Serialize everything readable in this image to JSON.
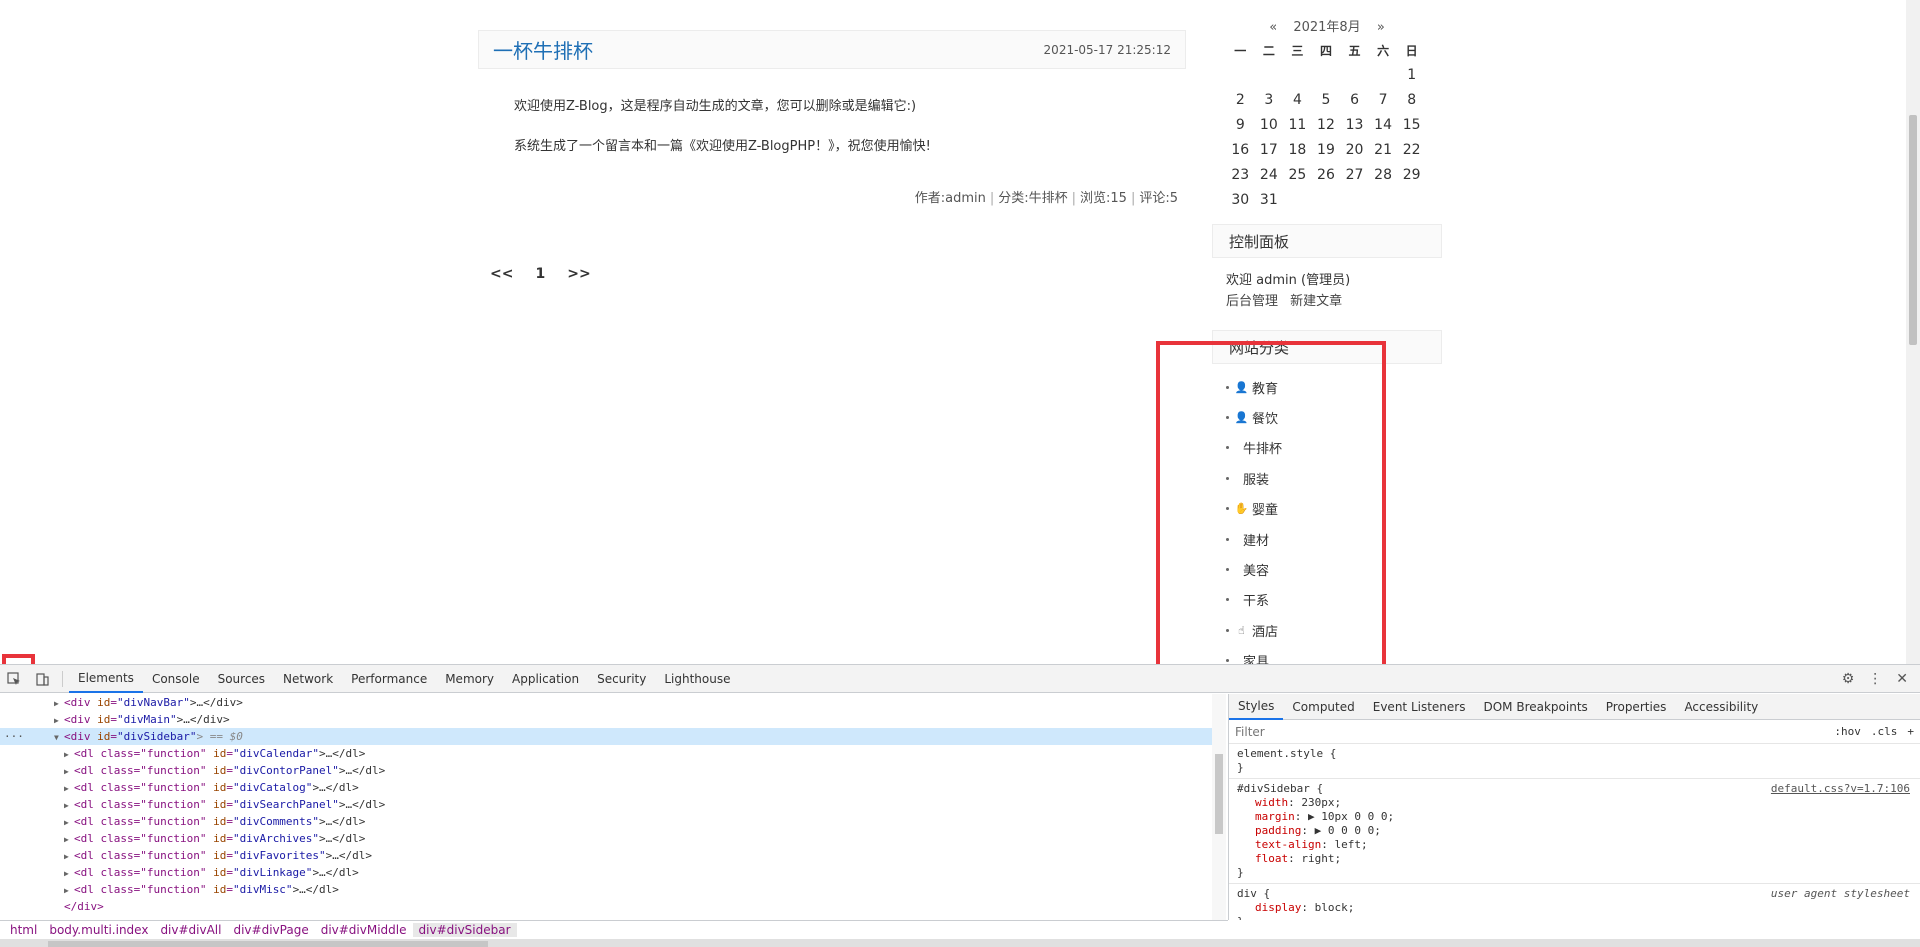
{
  "post": {
    "title": "一杯牛排杯",
    "date": "2021-05-17 21:25:12",
    "paragraphs": [
      "欢迎使用Z-Blog，这是程序自动生成的文章，您可以删除或是编辑它:)",
      "系统生成了一个留言本和一篇《欢迎使用Z-BlogPHP！》，祝您使用愉快!"
    ],
    "meta": {
      "author": "作者:admin",
      "category": "分类:牛排杯",
      "views": "浏览:15",
      "comments": "评论:5"
    }
  },
  "pager": {
    "prev": "<<",
    "page": "1",
    "next": ">>"
  },
  "calendar": {
    "prev": "«",
    "month": "2021年8月",
    "next": "»",
    "weekdays": [
      "一",
      "二",
      "三",
      "四",
      "五",
      "六",
      "日"
    ],
    "weeks": [
      [
        "",
        "",
        "",
        "",
        "",
        "",
        "1"
      ],
      [
        "2",
        "3",
        "4",
        "5",
        "6",
        "7",
        "8"
      ],
      [
        "9",
        "10",
        "11",
        "12",
        "13",
        "14",
        "15"
      ],
      [
        "16",
        "17",
        "18",
        "19",
        "20",
        "21",
        "22"
      ],
      [
        "23",
        "24",
        "25",
        "26",
        "27",
        "28",
        "29"
      ],
      [
        "30",
        "31",
        "",
        "",
        "",
        "",
        ""
      ]
    ]
  },
  "control_panel": {
    "title": "控制面板",
    "welcome": "欢迎 admin (管理员)",
    "links": [
      "后台管理",
      "新建文章"
    ]
  },
  "catalog": {
    "title": "网站分类",
    "items": [
      {
        "label": "教育",
        "icon": "user-card-icon"
      },
      {
        "label": "餐饮",
        "icon": "user-card-icon"
      },
      {
        "label": "牛排杯",
        "icon": ""
      },
      {
        "label": "服装",
        "icon": ""
      },
      {
        "label": "婴童",
        "icon": "hand-icon"
      },
      {
        "label": "建材",
        "icon": ""
      },
      {
        "label": "美容",
        "icon": ""
      },
      {
        "label": "干系",
        "icon": ""
      },
      {
        "label": "酒店",
        "icon": "pointer-hand-icon"
      },
      {
        "label": "家具",
        "icon": ""
      }
    ]
  },
  "devtools": {
    "tabs": [
      "Elements",
      "Console",
      "Sources",
      "Network",
      "Performance",
      "Memory",
      "Application",
      "Security",
      "Lighthouse"
    ],
    "active_tab": "Elements",
    "dom": [
      {
        "indent": 1,
        "arrow": "▶",
        "open": "<div ",
        "attr": "id",
        "val": "\"divNavBar\"",
        "rest": ">…</div>",
        "selected": false
      },
      {
        "indent": 1,
        "arrow": "▶",
        "open": "<div ",
        "attr": "id",
        "val": "\"divMain\"",
        "rest": ">…</div>",
        "selected": false
      },
      {
        "indent": 1,
        "arrow": "▼",
        "open": "<div ",
        "attr": "id",
        "val": "\"divSidebar\"",
        "rest": "> == $0",
        "selected": true
      },
      {
        "indent": 2,
        "arrow": "▶",
        "open": "<dl class=\"function\" ",
        "attr": "id",
        "val": "\"divCalendar\"",
        "rest": ">…</dl>",
        "selected": false
      },
      {
        "indent": 2,
        "arrow": "▶",
        "open": "<dl class=\"function\" ",
        "attr": "id",
        "val": "\"divContorPanel\"",
        "rest": ">…</dl>",
        "selected": false
      },
      {
        "indent": 2,
        "arrow": "▶",
        "open": "<dl class=\"function\" ",
        "attr": "id",
        "val": "\"divCatalog\"",
        "rest": ">…</dl>",
        "selected": false
      },
      {
        "indent": 2,
        "arrow": "▶",
        "open": "<dl class=\"function\" ",
        "attr": "id",
        "val": "\"divSearchPanel\"",
        "rest": ">…</dl>",
        "selected": false
      },
      {
        "indent": 2,
        "arrow": "▶",
        "open": "<dl class=\"function\" ",
        "attr": "id",
        "val": "\"divComments\"",
        "rest": ">…</dl>",
        "selected": false
      },
      {
        "indent": 2,
        "arrow": "▶",
        "open": "<dl class=\"function\" ",
        "attr": "id",
        "val": "\"divArchives\"",
        "rest": ">…</dl>",
        "selected": false
      },
      {
        "indent": 2,
        "arrow": "▶",
        "open": "<dl class=\"function\" ",
        "attr": "id",
        "val": "\"divFavorites\"",
        "rest": ">…</dl>",
        "selected": false
      },
      {
        "indent": 2,
        "arrow": "▶",
        "open": "<dl class=\"function\" ",
        "attr": "id",
        "val": "\"divLinkage\"",
        "rest": ">…</dl>",
        "selected": false
      },
      {
        "indent": 2,
        "arrow": "▶",
        "open": "<dl class=\"function\" ",
        "attr": "id",
        "val": "\"divMisc\"",
        "rest": ">…</dl>",
        "selected": false
      },
      {
        "indent": 1,
        "arrow": "",
        "open": "</div>",
        "attr": "",
        "val": "",
        "rest": "",
        "selected": false
      }
    ],
    "styles_tabs": [
      "Styles",
      "Computed",
      "Event Listeners",
      "DOM Breakpoints",
      "Properties",
      "Accessibility"
    ],
    "filter_placeholder": "Filter",
    "filter_buttons": [
      ":hov",
      ".cls",
      "+"
    ],
    "rules": [
      {
        "selector": "element.style {",
        "source": "",
        "ua": "",
        "props": [],
        "close": "}"
      },
      {
        "selector": "#divSidebar {",
        "source": "default.css?v=1.7:106",
        "ua": "",
        "props": [
          [
            "width",
            "230px;"
          ],
          [
            "margin",
            "▶ 10px 0 0 0;"
          ],
          [
            "padding",
            "▶ 0 0 0 0;"
          ],
          [
            "text-align",
            "left;"
          ],
          [
            "float",
            "right;"
          ]
        ],
        "close": "}"
      },
      {
        "selector": "div {",
        "source": "",
        "ua": "user agent stylesheet",
        "props": [
          [
            "display",
            "block;"
          ]
        ],
        "close": "}"
      }
    ],
    "breadcrumbs": [
      "html",
      "body.multi.index",
      "div#divAll",
      "div#divPage",
      "div#divMiddle",
      "div#divSidebar"
    ]
  },
  "colors": {
    "highlight": "#e8333a",
    "link": "#1e6fb5",
    "selection": "#cfe8fc"
  }
}
